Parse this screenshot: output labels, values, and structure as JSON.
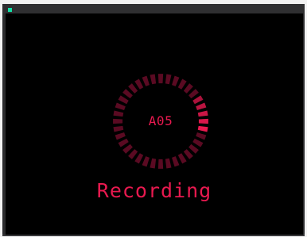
{
  "recorder": {
    "code": "A05",
    "status": "Recording",
    "indicator_icon": "status-led-icon",
    "spinner_icon": "loading-ring-icon",
    "segments_total": 36,
    "segments_bright": 5,
    "colors": {
      "accent": "#e8194f",
      "segment_dim": "#5a0a22",
      "led": "#12e0a6",
      "screen_bg": "#000000",
      "frame": "#2b2b2d"
    }
  }
}
